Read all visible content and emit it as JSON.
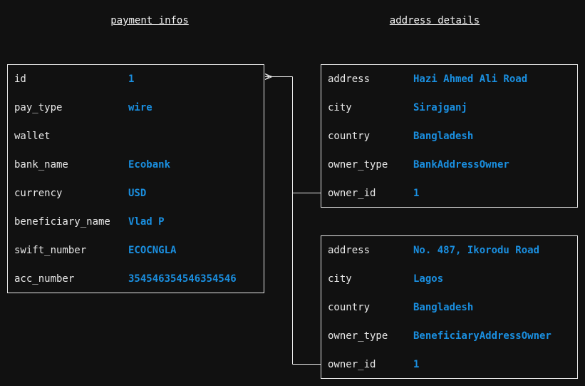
{
  "colors": {
    "background": "#111111",
    "border": "#e8e8e8",
    "key_text": "#e8e8e8",
    "value_text": "#1a8fe0"
  },
  "payment": {
    "title": "payment infos",
    "rows": [
      {
        "key": "id",
        "value": "1"
      },
      {
        "key": "pay_type",
        "value": "wire"
      },
      {
        "key": "wallet",
        "value": ""
      },
      {
        "key": "bank_name",
        "value": "Ecobank"
      },
      {
        "key": "currency",
        "value": "USD"
      },
      {
        "key": "beneficiary_name",
        "value": "Vlad P"
      },
      {
        "key": "swift_number",
        "value": "ECOCNGLA"
      },
      {
        "key": "acc_number",
        "value": "354546354546354546"
      }
    ]
  },
  "addresses": {
    "title": "address details",
    "items": [
      {
        "rows": [
          {
            "key": "address",
            "value": "Hazi Ahmed Ali Road"
          },
          {
            "key": "city",
            "value": "Sirajganj"
          },
          {
            "key": "country",
            "value": "Bangladesh"
          },
          {
            "key": "owner_type",
            "value": "BankAddressOwner"
          },
          {
            "key": "owner_id",
            "value": "1"
          }
        ]
      },
      {
        "rows": [
          {
            "key": "address",
            "value": "No. 487, Ikorodu Road"
          },
          {
            "key": "city",
            "value": "Lagos"
          },
          {
            "key": "country",
            "value": "Bangladesh"
          },
          {
            "key": "owner_type",
            "value": "BeneficiaryAddressOwner"
          },
          {
            "key": "owner_id",
            "value": "1"
          }
        ]
      }
    ]
  }
}
